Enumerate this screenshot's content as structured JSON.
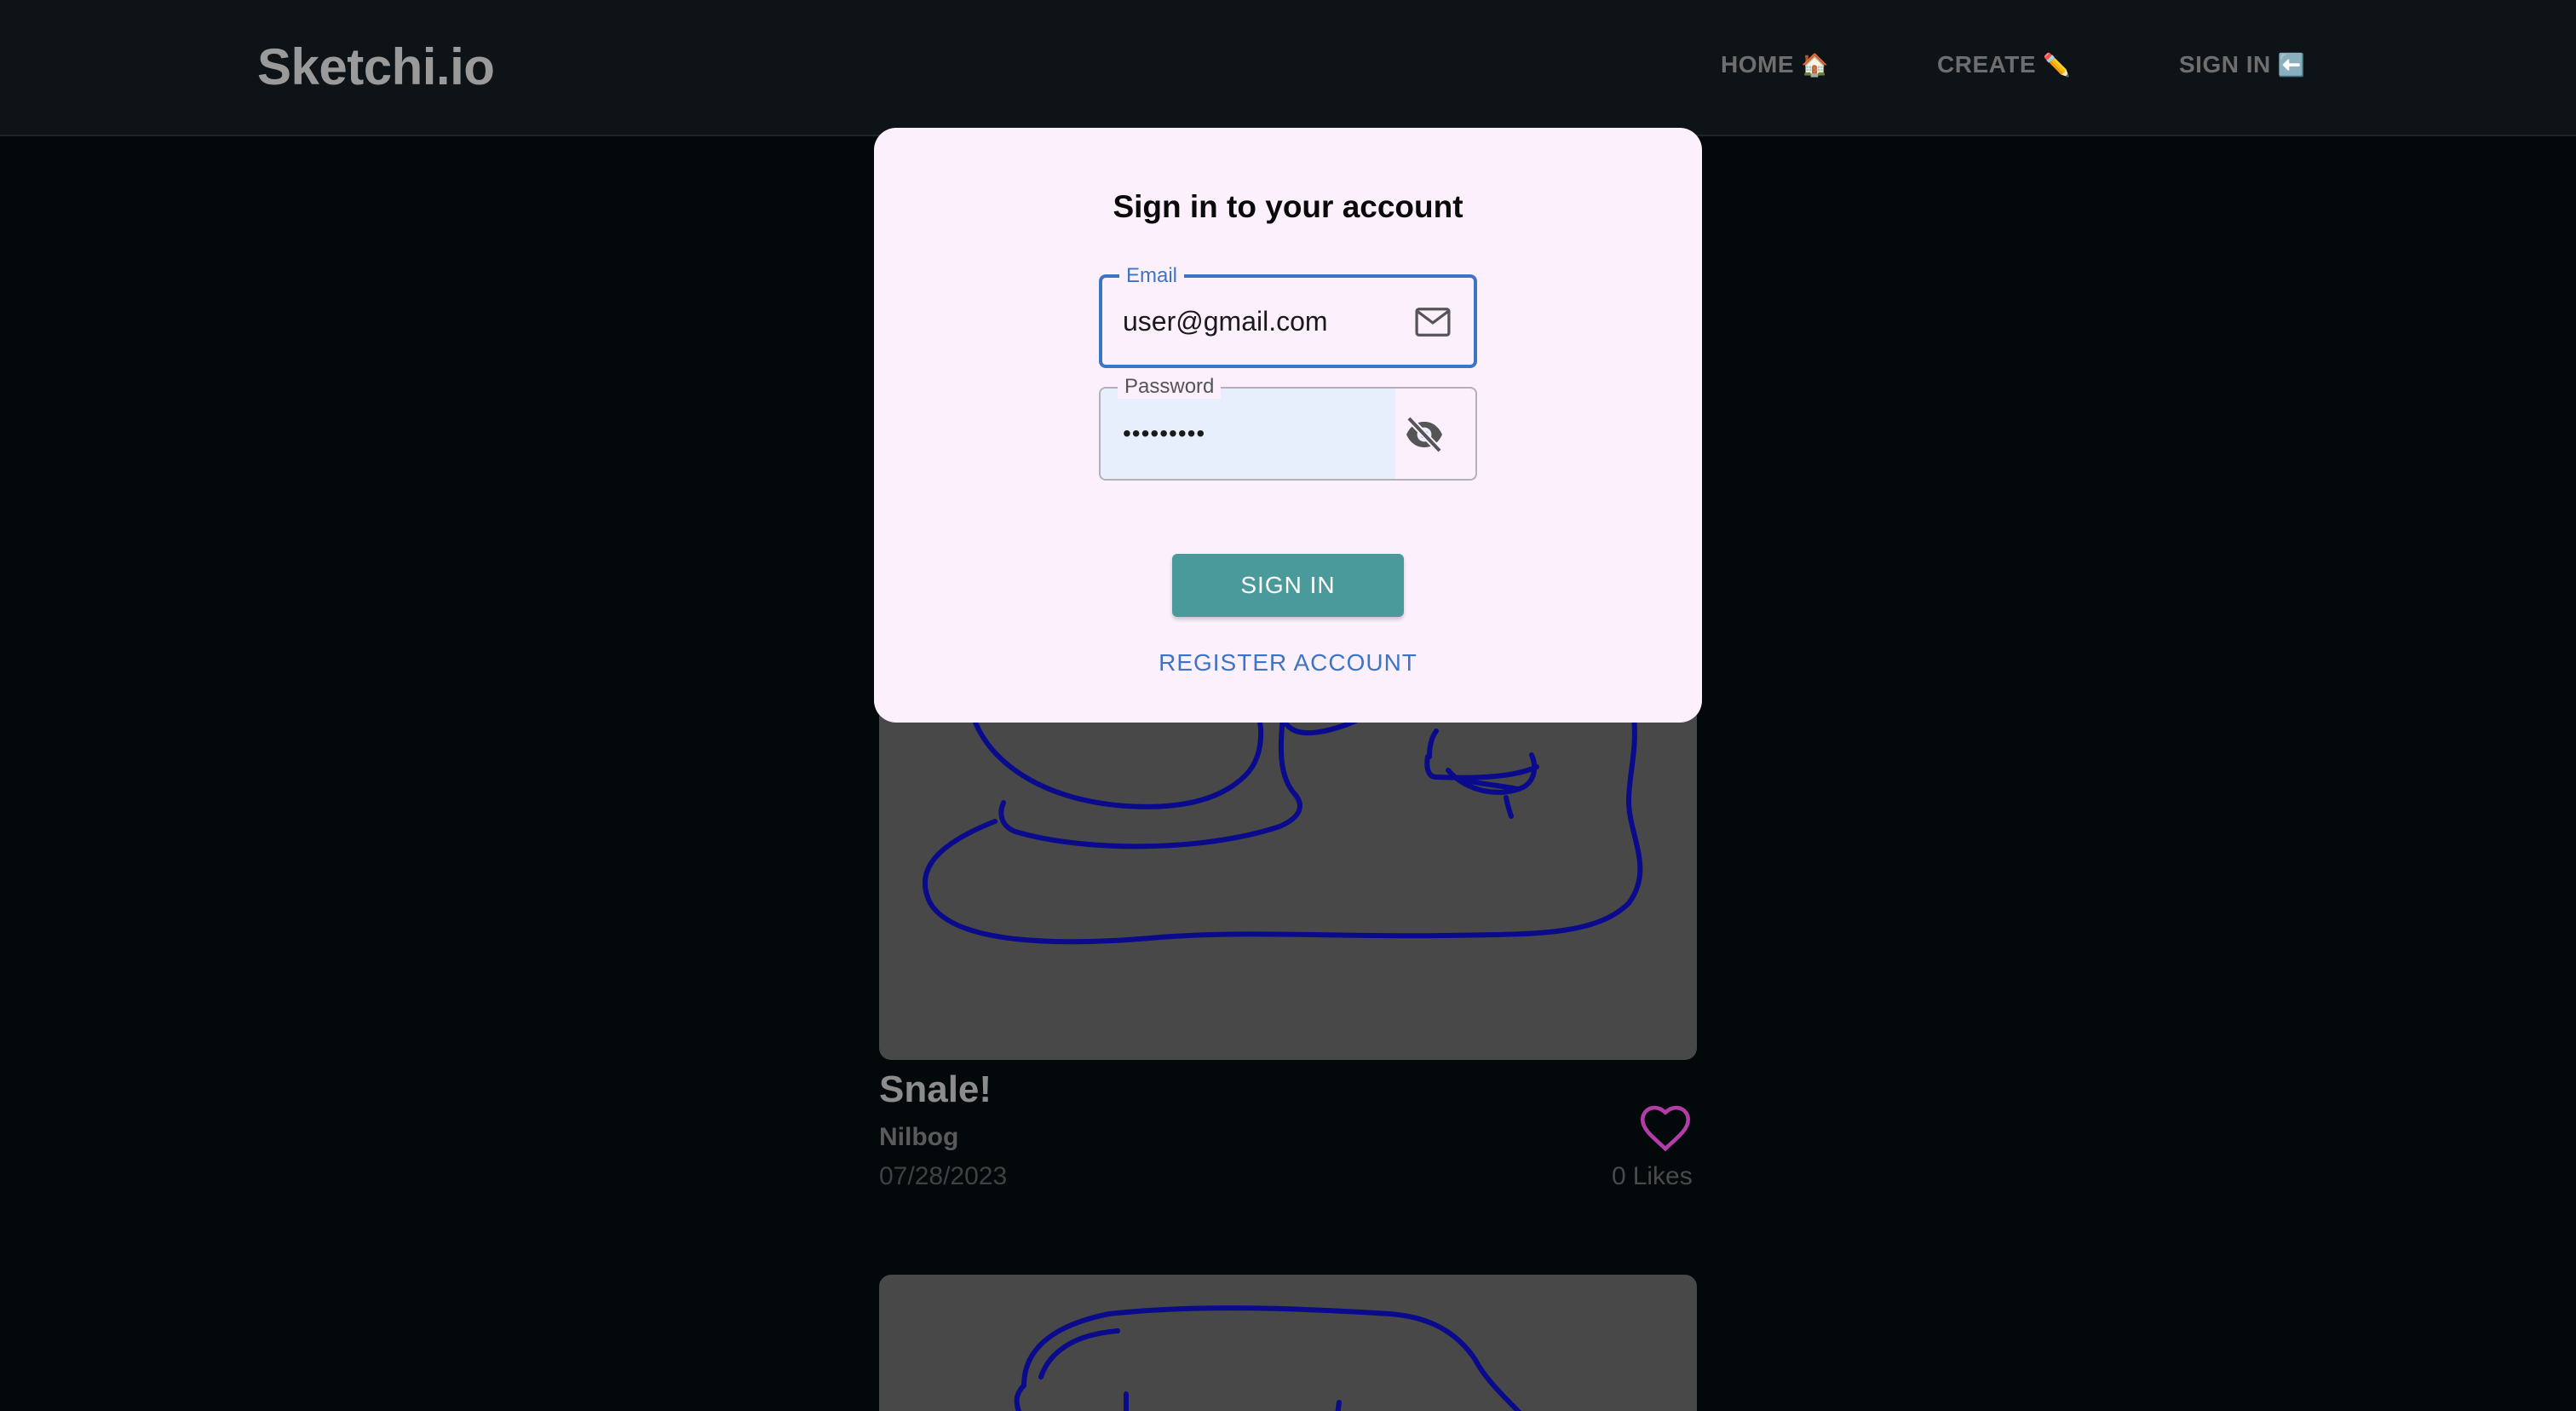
{
  "navbar": {
    "brand": "Sketchi.io",
    "links": [
      {
        "label": "HOME",
        "icon": "🏠"
      },
      {
        "label": "CREATE",
        "icon": "✏️"
      },
      {
        "label": "SIGN IN",
        "icon": "⬅️"
      }
    ]
  },
  "post": {
    "title": "Snale!",
    "author": "Nilbog",
    "date": "07/28/2023",
    "likes_count": "0",
    "likes_label": "Likes"
  },
  "modal": {
    "title": "Sign in to your account",
    "email_label": "Email",
    "email_value": "user@gmail.com",
    "password_label": "Password",
    "password_value": "•••••••••",
    "signin_label": "SIGN IN",
    "register_label": "REGISTER ACCOUNT"
  },
  "colors": {
    "background": "#03080b",
    "navbar": "#0e1317",
    "modal": "#fdf0fd",
    "accent_blue": "#3e74c4",
    "button_teal": "#4a9a9b",
    "heart": "#b43ca8",
    "sketch_stroke": "#0a0a8c"
  },
  "icons": {
    "email_field": "mail-icon",
    "password_field": "eye-off-icon",
    "like": "heart-icon"
  }
}
